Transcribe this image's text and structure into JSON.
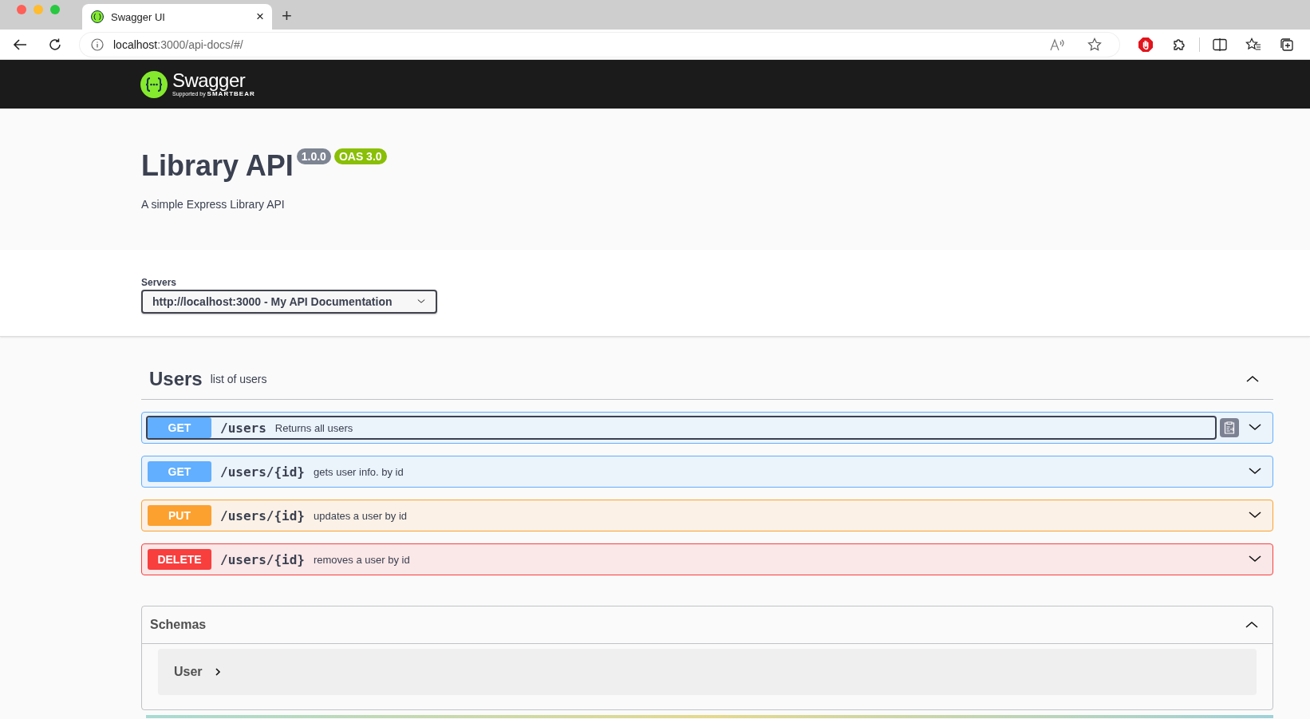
{
  "browser": {
    "tab_title": "Swagger UI",
    "tab_close": "×",
    "new_tab": "+",
    "url_host": "localhost",
    "url_path": ":3000/api-docs/#/"
  },
  "header": {
    "logo_text": "Swagger",
    "logo_sub_prefix": "Supported by",
    "logo_sub_brand": "SMARTBEAR"
  },
  "info": {
    "title": "Library API",
    "version": "1.0.0",
    "oas": "OAS 3.0",
    "description": "A simple Express Library API"
  },
  "servers": {
    "label": "Servers",
    "selected": "http://localhost:3000 - My API Documentation"
  },
  "tag": {
    "name": "Users",
    "description": "list of users",
    "expanded": true
  },
  "operations": [
    {
      "method": "GET",
      "path": "/users",
      "summary": "Returns all users",
      "focused": true
    },
    {
      "method": "GET",
      "path": "/users/{id}",
      "summary": "gets user info. by id",
      "focused": false
    },
    {
      "method": "PUT",
      "path": "/users/{id}",
      "summary": "updates a user by id",
      "focused": false
    },
    {
      "method": "DELETE",
      "path": "/users/{id}",
      "summary": "removes a user by id",
      "focused": false
    }
  ],
  "schemas": {
    "title": "Schemas",
    "expanded": true,
    "items": [
      {
        "name": "User"
      }
    ]
  }
}
